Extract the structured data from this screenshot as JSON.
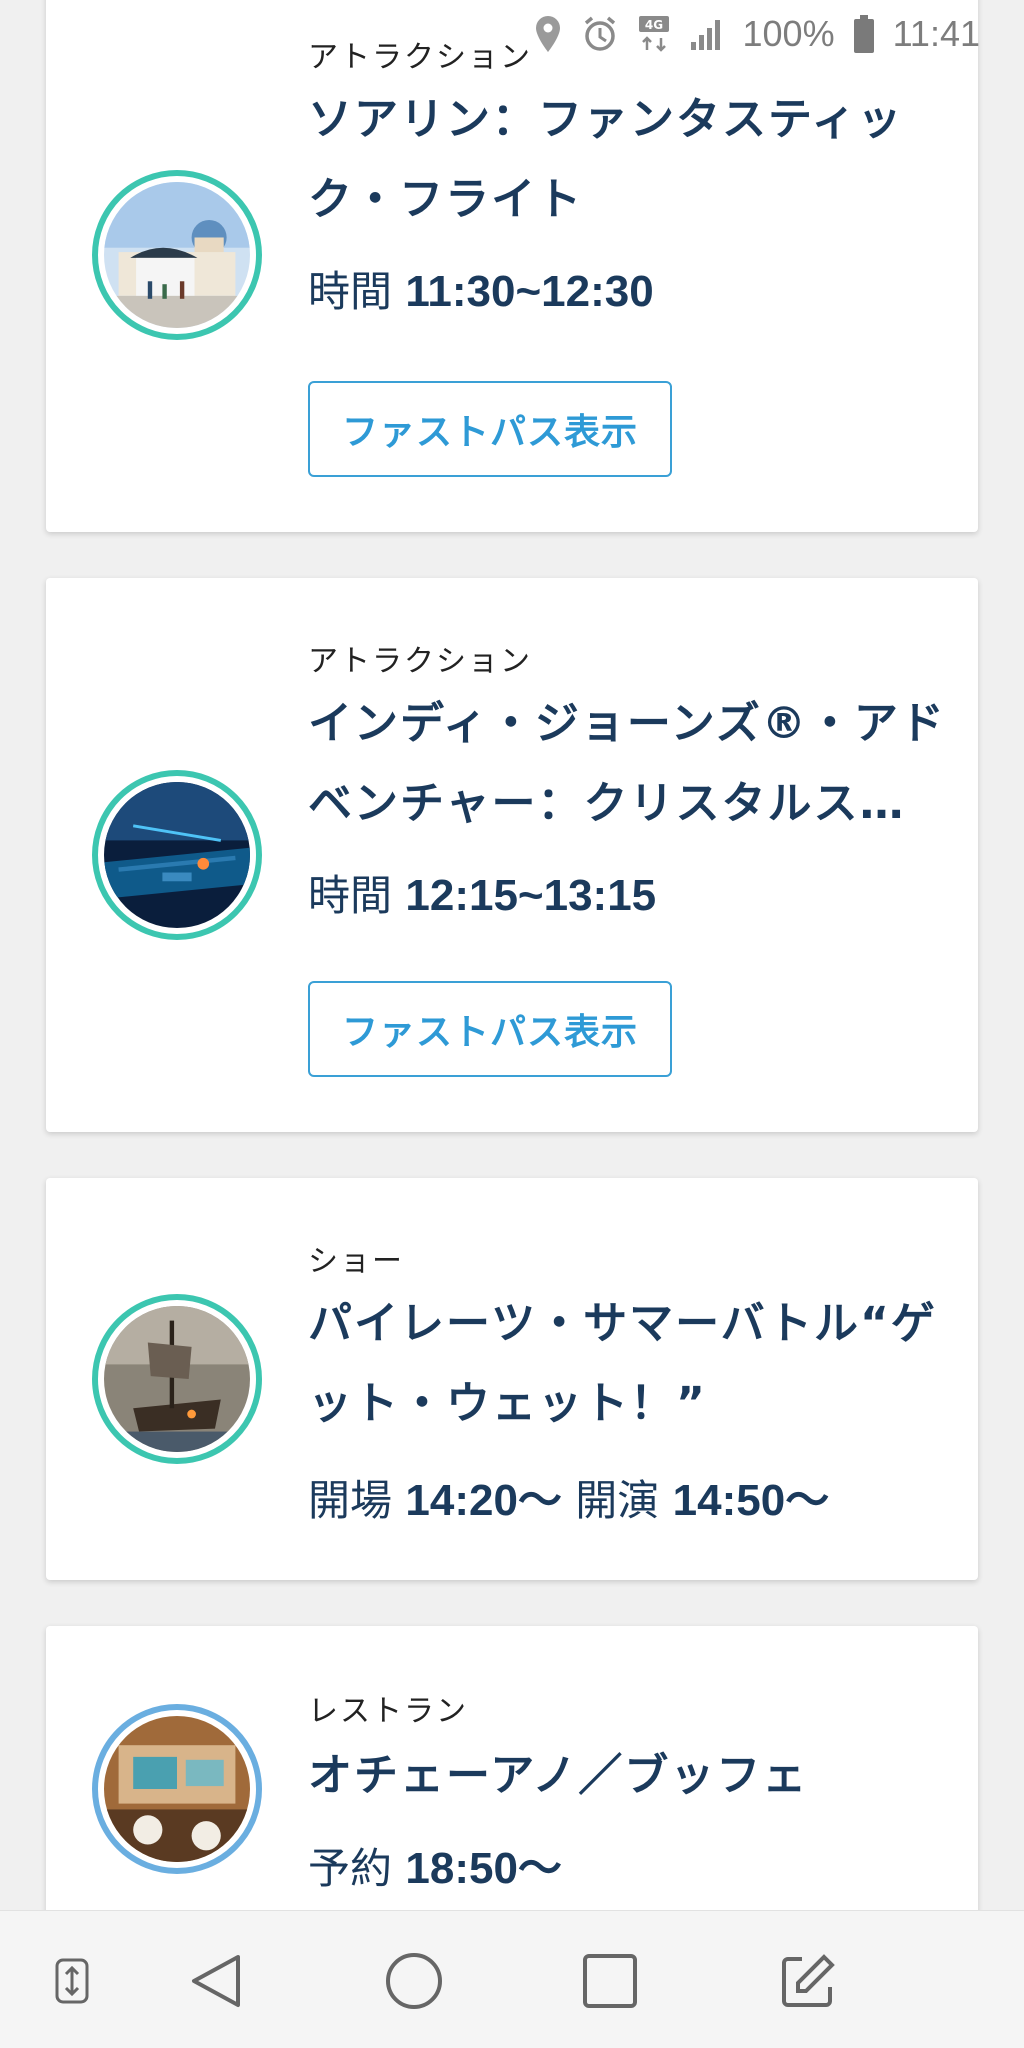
{
  "status_bar": {
    "battery": "100%",
    "time": "11:41",
    "network": "4G",
    "icons": [
      "location-icon",
      "alarm-icon",
      "network-4g-icon",
      "signal-icon",
      "battery-icon"
    ]
  },
  "cards": [
    {
      "category": "アトラクション",
      "title": "ソアリン：ファンタスティック・フライト",
      "time_label": "時間",
      "time_value": "11:30~12:30",
      "button_label": "ファストパス表示",
      "ring_color": "#3cc6b0"
    },
    {
      "category": "アトラクション",
      "title": "インディ・ジョーンズ®・アドベンチャー：クリスタルス…",
      "time_label": "時間",
      "time_value": "12:15~13:15",
      "button_label": "ファストパス表示",
      "ring_color": "#3cc6b0"
    },
    {
      "category": "ショー",
      "title": "パイレーツ・サマーバトル“ゲット・ウェット！”",
      "time_label": "開場",
      "time_value": "14:20〜",
      "time_label2": "開演",
      "time_value2": "14:50〜",
      "ring_color": "#3cc6b0"
    },
    {
      "category": "レストラン",
      "title": "オチェーアノ／ブッフェ",
      "time_label": "予約",
      "time_value": "18:50〜",
      "ring_color": "#6aaee0"
    }
  ],
  "nav_bar": {
    "icons": [
      "swap-icon",
      "back-icon",
      "home-icon",
      "recents-icon",
      "edit-icon"
    ]
  },
  "colors": {
    "title_text": "#1b3a5c",
    "button_border": "#3aa0d6",
    "accent_teal": "#3cc6b0"
  }
}
